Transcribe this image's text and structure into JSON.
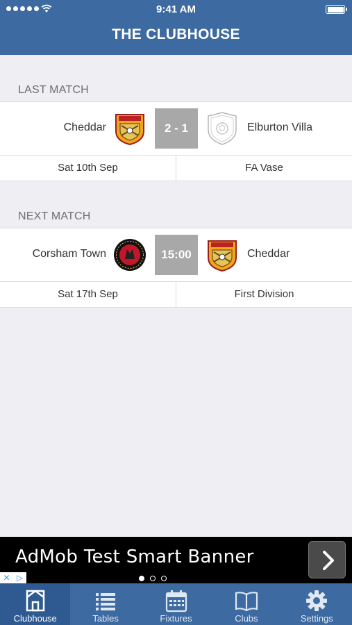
{
  "status_bar": {
    "time": "9:41 AM"
  },
  "header": {
    "title": "THE CLUBHOUSE"
  },
  "last_match": {
    "heading": "LAST MATCH",
    "home_team": "Cheddar",
    "away_team": "Elburton Villa",
    "score": "2 - 1",
    "date": "Sat 10th Sep",
    "competition": "FA Vase"
  },
  "next_match": {
    "heading": "NEXT MATCH",
    "home_team": "Corsham Town",
    "away_team": "Cheddar",
    "kickoff": "15:00",
    "date": "Sat 17th Sep",
    "competition": "First Division"
  },
  "ad": {
    "text": "AdMob Test Smart Banner"
  },
  "tabs": [
    {
      "label": "Clubhouse",
      "icon": "clubhouse-icon",
      "active": true
    },
    {
      "label": "Tables",
      "icon": "list-icon",
      "active": false
    },
    {
      "label": "Fixtures",
      "icon": "calendar-icon",
      "active": false
    },
    {
      "label": "Clubs",
      "icon": "book-icon",
      "active": false
    },
    {
      "label": "Settings",
      "icon": "gear-icon",
      "active": false
    }
  ],
  "colors": {
    "brand": "#3d6aa1",
    "score_bg": "#a8a8a8",
    "background": "#eeeef3"
  }
}
